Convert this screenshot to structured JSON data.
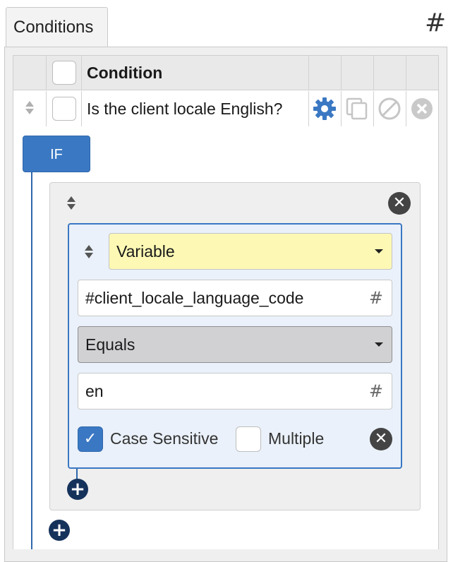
{
  "tab": {
    "label": "Conditions"
  },
  "top_hash": "#",
  "grid": {
    "header": {
      "column_label": "Condition"
    },
    "rows": [
      {
        "label": "Is the client locale English?"
      }
    ]
  },
  "if_block": {
    "label": "IF"
  },
  "condition": {
    "type_select": {
      "value": "Variable"
    },
    "variable_field": {
      "value": "#client_locale_language_code",
      "hash": "#"
    },
    "operator_select": {
      "value": "Equals"
    },
    "value_field": {
      "value": "en",
      "hash": "#"
    },
    "case_sensitive": {
      "label": "Case Sensitive",
      "checked": true
    },
    "multiple": {
      "label": "Multiple",
      "checked": false
    },
    "close_glyph": "✕"
  },
  "group_close_glyph": "✕",
  "add_glyph": "+",
  "colors": {
    "accent": "#3a78c3",
    "variable_bg": "#fdf9b5",
    "operator_bg": "#d1d1d4",
    "add_button": "#15325b"
  }
}
